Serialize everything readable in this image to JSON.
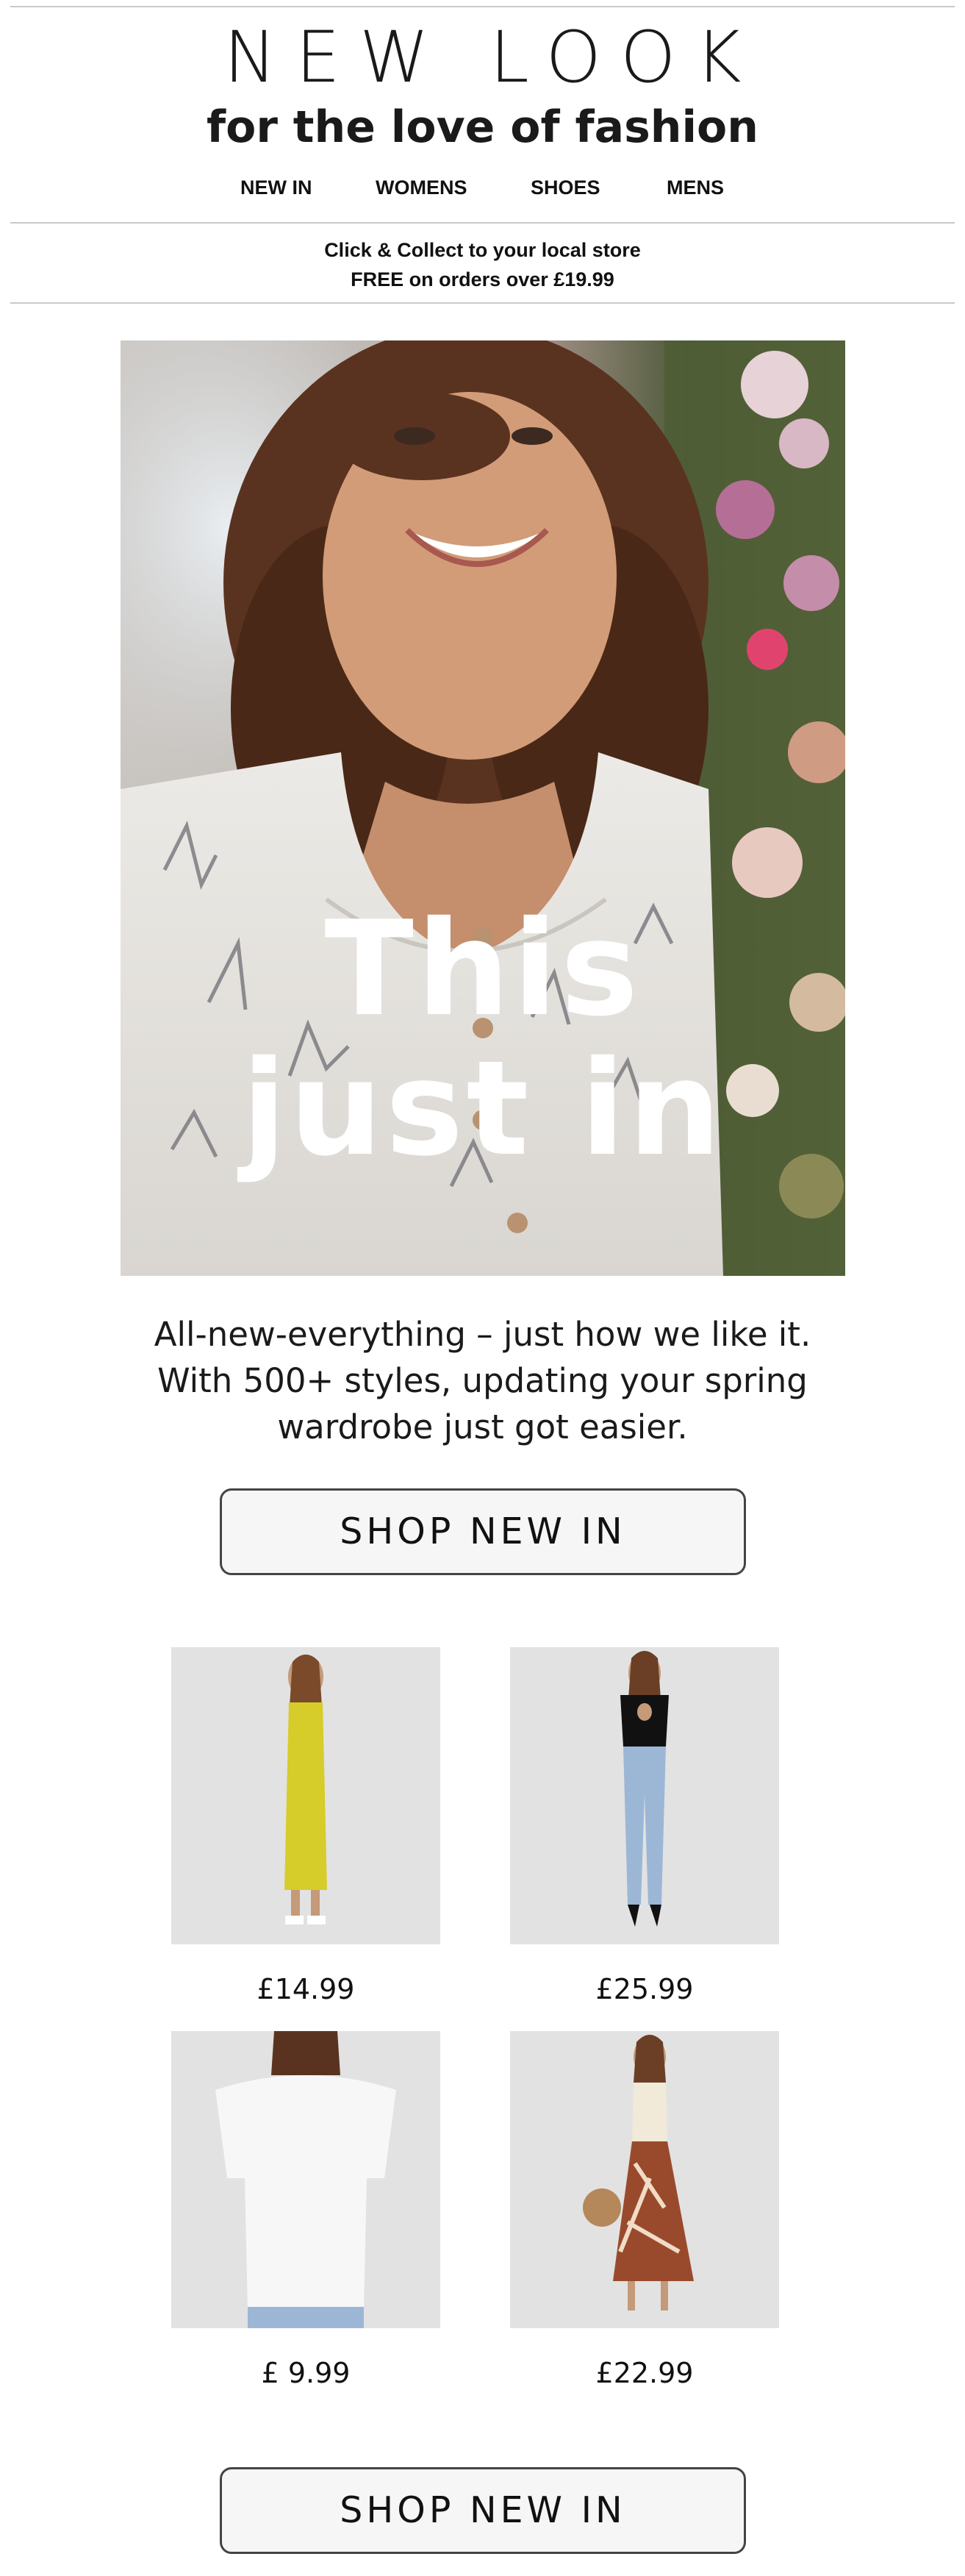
{
  "header": {
    "logo": "NEW LOOK",
    "tagline": "for the love of fashion",
    "nav": [
      "NEW IN",
      "WOMENS",
      "SHOES",
      "MENS"
    ]
  },
  "promo": {
    "line1": "Click & Collect to your local store",
    "line2": "FREE on orders over £19.99"
  },
  "hero": {
    "headline_line1": "This",
    "headline_line2": "just in"
  },
  "intro": {
    "line1": "All-new-everything – just how we like it.",
    "line2": "With 500+ styles, updating your spring",
    "line3": "wardrobe just got easier."
  },
  "cta_top": "SHOP NEW IN",
  "products": [
    {
      "price": "£14.99",
      "color": "#d6cc2a",
      "item": "yellow ribbed midi dress"
    },
    {
      "price": "£25.99",
      "color": "#111111",
      "item": "black cut-out top with light blue jeans"
    },
    {
      "price": "£ 9.99",
      "color": "#f4f4f4",
      "item": "white oversized tee"
    },
    {
      "price": "£22.99",
      "color": "#9a4a2c",
      "item": "rust leaf print midi skirt"
    }
  ],
  "cta_bottom": "SHOP NEW IN",
  "colors": {
    "text": "#111111",
    "rule": "#c9c9c9",
    "button_bg": "#f6f6f6"
  }
}
